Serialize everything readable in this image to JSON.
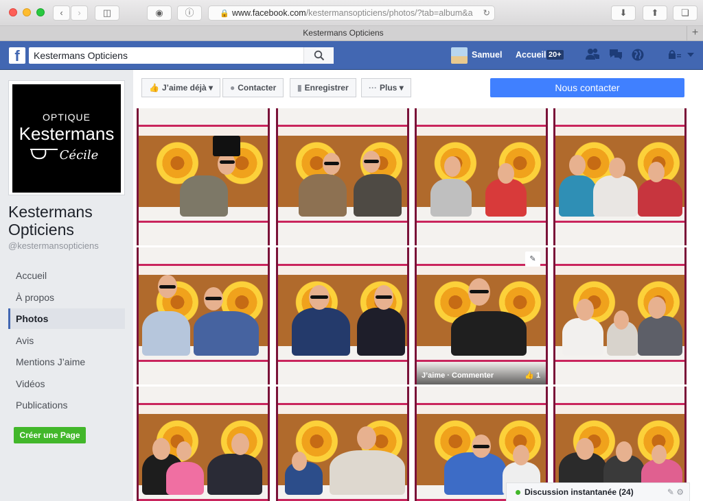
{
  "browser": {
    "url_host": "www.facebook.com",
    "url_path": "/kestermansopticiens/photos/?tab=album&a",
    "tab_title": "Kestermans Opticiens",
    "new_tab": "+"
  },
  "fb_header": {
    "logo": "f",
    "search_value": "Kestermans Opticiens",
    "user_name": "Samuel",
    "home_label": "Accueil",
    "home_badge": "20+"
  },
  "profile": {
    "logo_line1": "OPTIQUE",
    "logo_line2": "Kestermans",
    "logo_line3": "Cécile",
    "page_name": "Kestermans Opticiens",
    "page_username": "@kestermansopticiens"
  },
  "sidebar": {
    "items": [
      {
        "label": "Accueil"
      },
      {
        "label": "À propos"
      },
      {
        "label": "Photos",
        "active": true
      },
      {
        "label": "Avis"
      },
      {
        "label": "Mentions J’aime"
      },
      {
        "label": "Vidéos"
      },
      {
        "label": "Publications"
      }
    ],
    "create_page": "Créer une Page"
  },
  "actions": {
    "like": "J’aime déjà",
    "contact": "Contacter",
    "save": "Enregistrer",
    "more": "Plus",
    "contact_us": "Nous contacter"
  },
  "photo_overlay": {
    "like_comment": "J’aime · Commenter",
    "like_count": "1"
  },
  "chat": {
    "label": "Discussion instantanée (24)"
  }
}
